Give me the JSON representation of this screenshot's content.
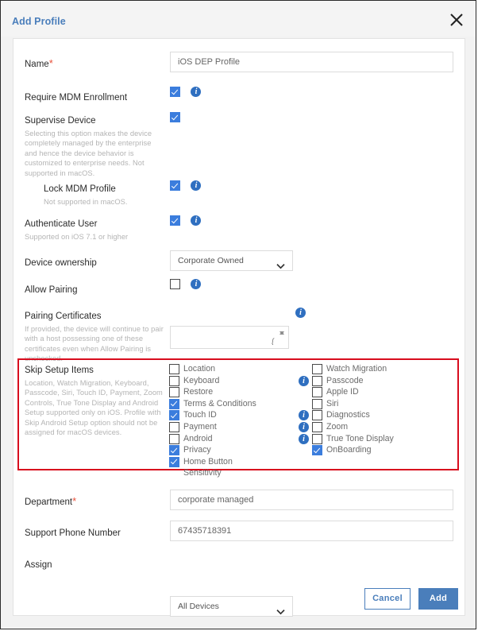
{
  "header": {
    "title": "Add Profile",
    "close_icon": "close-icon"
  },
  "form": {
    "name": {
      "label": "Name",
      "required": true,
      "value": "iOS DEP Profile"
    },
    "require_mdm_enrollment": {
      "label": "Require MDM Enrollment",
      "checked": true,
      "has_info": true
    },
    "supervise_device": {
      "label": "Supervise Device",
      "description": "Selecting this option makes the device completely managed by the enterprise and hence the device behavior is customized to enterprise needs. Not supported in macOS.",
      "checked": true,
      "has_info": false
    },
    "lock_mdm_profile": {
      "label": "Lock MDM Profile",
      "description": "Not supported in macOS.",
      "checked": true,
      "has_info": true
    },
    "authenticate_user": {
      "label": "Authenticate User",
      "description": "Supported on iOS 7.1 or higher",
      "checked": true,
      "has_info": true
    },
    "device_ownership": {
      "label": "Device ownership",
      "value": "Corporate Owned",
      "options": [
        "Corporate Owned"
      ]
    },
    "allow_pairing": {
      "label": "Allow Pairing",
      "checked": false,
      "has_info": true
    },
    "pairing_certificates": {
      "label": "Pairing Certificates",
      "description": "If provided, the device will continue to pair with a host possessing one of these certificates even when Allow Pairing is unchecked.",
      "value": "",
      "has_info": true
    },
    "skip_setup_items": {
      "label": "Skip Setup Items",
      "description": "Location, Watch Migration, Keyboard, Passcode, Siri, Touch ID, Payment, Zoom Controls, True Tone Display and Android Setup supported only on iOS. Profile with Skip Android Setup option should not be assigned for macOS devices.",
      "highlight_color": "#d80d1e",
      "left_column": [
        {
          "label": "Location",
          "checked": false,
          "has_info": false
        },
        {
          "label": "Keyboard",
          "checked": false,
          "has_info": false
        },
        {
          "label": "Restore",
          "checked": false,
          "has_info": false
        },
        {
          "label": "Terms & Conditions",
          "checked": true,
          "has_info": false
        },
        {
          "label": "Touch ID",
          "checked": true,
          "has_info": false
        },
        {
          "label": "Payment",
          "checked": false,
          "has_info": false
        },
        {
          "label": "Android",
          "checked": false,
          "has_info": false
        },
        {
          "label": "Privacy",
          "checked": true,
          "has_info": false
        },
        {
          "label": "Home Button Sensitivity",
          "checked": true,
          "has_info": false
        }
      ],
      "right_column": [
        {
          "label": "Watch Migration",
          "checked": false,
          "has_info": false
        },
        {
          "label": "Passcode",
          "checked": false,
          "has_info": true
        },
        {
          "label": "Apple ID",
          "checked": false,
          "has_info": false
        },
        {
          "label": "Siri",
          "checked": false,
          "has_info": false
        },
        {
          "label": "Diagnostics",
          "checked": false,
          "has_info": true
        },
        {
          "label": "Zoom",
          "checked": false,
          "has_info": true
        },
        {
          "label": "True Tone Display",
          "checked": false,
          "has_info": true
        },
        {
          "label": "OnBoarding",
          "checked": true,
          "has_info": false
        }
      ]
    },
    "department": {
      "label": "Department",
      "required": true,
      "value": "corporate managed"
    },
    "support_phone_number": {
      "label": "Support Phone Number",
      "value": "67435718391"
    },
    "assign": {
      "label": "Assign",
      "value": "All Devices",
      "options": [
        "All Devices"
      ]
    }
  },
  "footer": {
    "cancel_label": "Cancel",
    "add_label": "Add"
  },
  "colors": {
    "accent": "#4a7ebb",
    "checkbox_on": "#3b7ddd",
    "info_icon": "#2f6fc0",
    "highlight": "#d80d1e",
    "required": "#e8503a"
  }
}
